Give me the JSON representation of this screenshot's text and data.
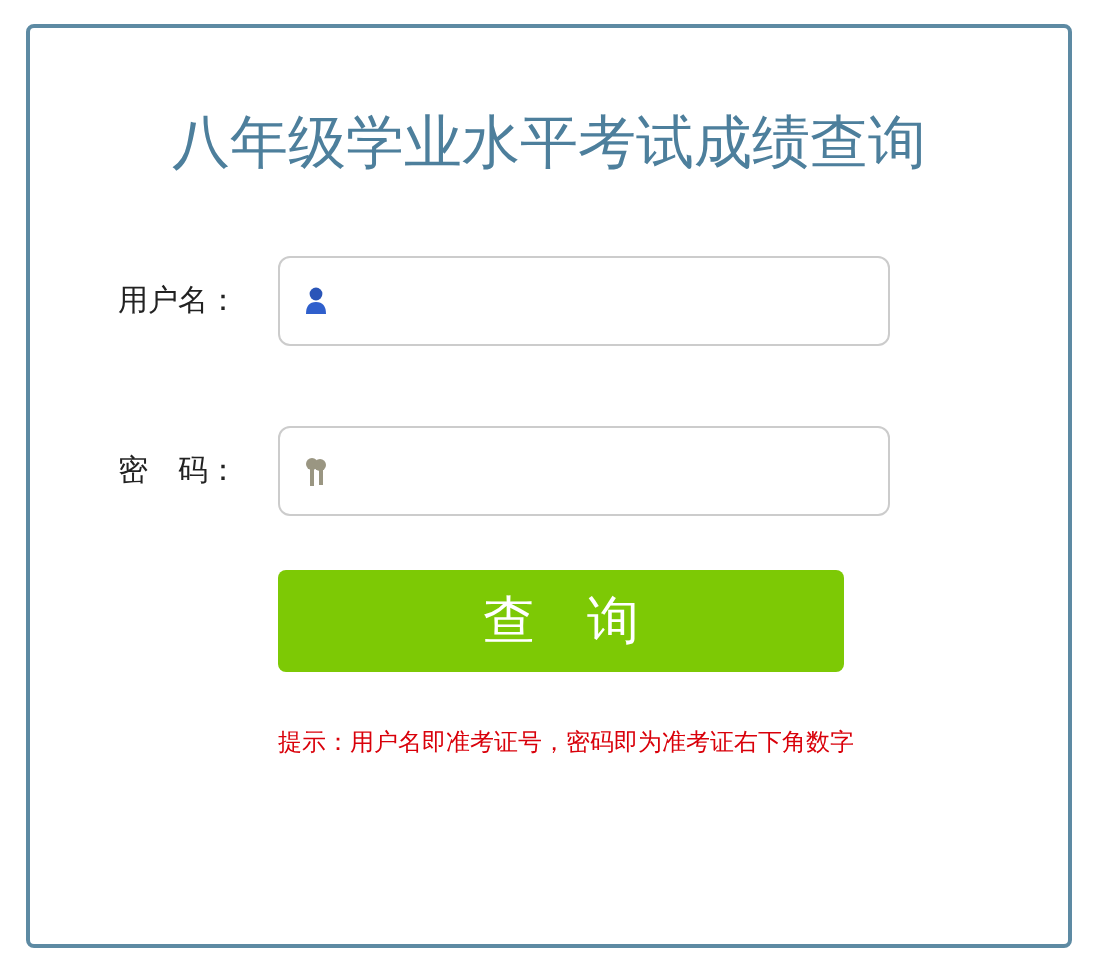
{
  "title": "八年级学业水平考试成绩查询",
  "fields": [
    {
      "label": "用户名：",
      "kind": "user"
    },
    {
      "label": "密　码：",
      "kind": "password"
    }
  ],
  "submit": "查　询",
  "hint": "提示：用户名即准考证号，密码即为准考证右下角数字"
}
